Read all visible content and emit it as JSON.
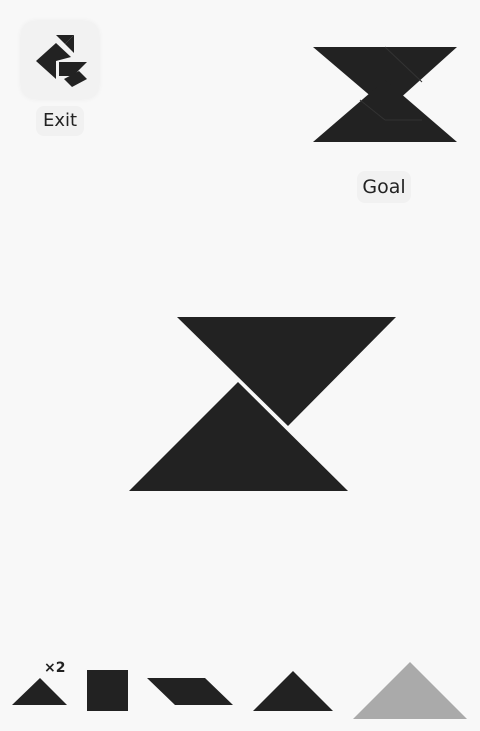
{
  "header": {
    "exit_label": "Exit",
    "goal_label": "Goal"
  },
  "tray": {
    "small_triangle_count": "×2"
  },
  "colors": {
    "piece": "#222222",
    "piece_selected": "#aaaaaa",
    "background": "#f8f8f8"
  },
  "icons": {
    "exit": "tangram-bird-icon"
  }
}
